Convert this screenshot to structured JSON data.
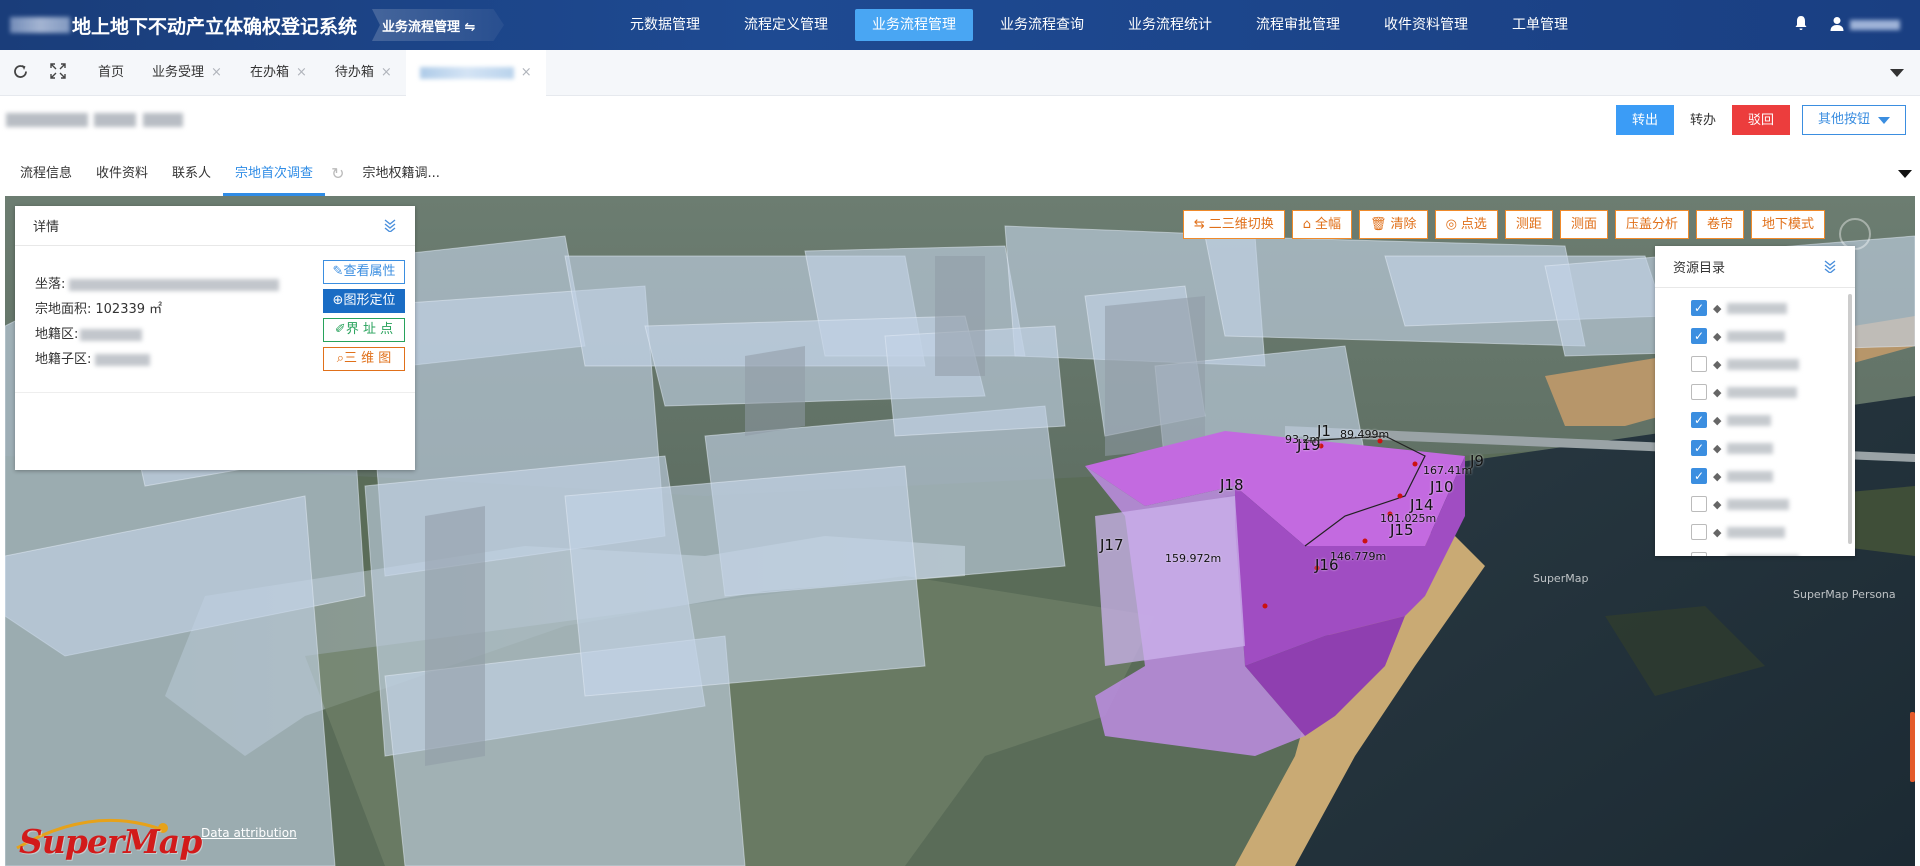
{
  "app": {
    "title": "地上地下不动产立体确权登记系统",
    "badge": "业务流程管理 ⇋",
    "nav": [
      {
        "label": "元数据管理",
        "active": false
      },
      {
        "label": "流程定义管理",
        "active": false
      },
      {
        "label": "业务流程管理",
        "active": true
      },
      {
        "label": "业务流程查询",
        "active": false
      },
      {
        "label": "业务流程统计",
        "active": false
      },
      {
        "label": "流程审批管理",
        "active": false
      },
      {
        "label": "收件资料管理",
        "active": false
      },
      {
        "label": "工单管理",
        "active": false
      }
    ],
    "bell_icon": "bell-icon",
    "user_icon": "user-icon"
  },
  "tabbar": {
    "tabs": [
      {
        "label": "首页",
        "closable": false
      },
      {
        "label": "业务受理",
        "closable": true
      },
      {
        "label": "在办箱",
        "closable": true
      },
      {
        "label": "待办箱",
        "closable": true
      }
    ],
    "close_glyph": "×"
  },
  "actions": {
    "transfer_out": "转出",
    "transfer": "转办",
    "reject": "驳回",
    "more": "其他按钮"
  },
  "subtabs": [
    {
      "label": "流程信息",
      "active": false
    },
    {
      "label": "收件资料",
      "active": false
    },
    {
      "label": "联系人",
      "active": false
    },
    {
      "label": "宗地首次调查",
      "active": true
    },
    {
      "label": "宗地权籍调...",
      "active": false
    }
  ],
  "map_toolbar": [
    {
      "label": "二三维切换",
      "icon": "switch-icon"
    },
    {
      "label": "全幅",
      "icon": "home-icon"
    },
    {
      "label": "清除",
      "icon": "trash-icon"
    },
    {
      "label": "点选",
      "icon": "target-icon"
    },
    {
      "label": "测距",
      "icon": ""
    },
    {
      "label": "测面",
      "icon": ""
    },
    {
      "label": "压盖分析",
      "icon": ""
    },
    {
      "label": "卷帘",
      "icon": ""
    },
    {
      "label": "地下模式",
      "icon": ""
    }
  ],
  "details": {
    "title": "详情",
    "location_label": "坐落:",
    "area_label": "宗地面积:",
    "area_value": "102339 ㎡",
    "district_label": "地籍区:",
    "subdistrict_label": "地籍子区:",
    "buttons": {
      "view_attr": "查看属性",
      "locate": "图形定位",
      "boundary": "界 址 点",
      "three_d": "三 维 图"
    }
  },
  "resources": {
    "title": "资源目录",
    "items": [
      {
        "checked": true
      },
      {
        "checked": true
      },
      {
        "checked": false
      },
      {
        "checked": false
      },
      {
        "checked": true
      },
      {
        "checked": true
      },
      {
        "checked": true
      },
      {
        "checked": false
      },
      {
        "checked": false
      },
      {
        "checked": false
      }
    ]
  },
  "map": {
    "logo": "SuperMap",
    "attribution": "Data attribution",
    "watermark": "SuperMap",
    "watermark2": "SuperMap Persona",
    "point_labels": [
      "J1",
      "J19",
      "J18",
      "J15",
      "J16",
      "J17",
      "J14",
      "J10",
      "J9"
    ],
    "dim_labels": [
      "89.499m",
      "93.2m",
      "167.41m",
      "101.025m",
      "146.779m",
      "159.972m"
    ]
  }
}
